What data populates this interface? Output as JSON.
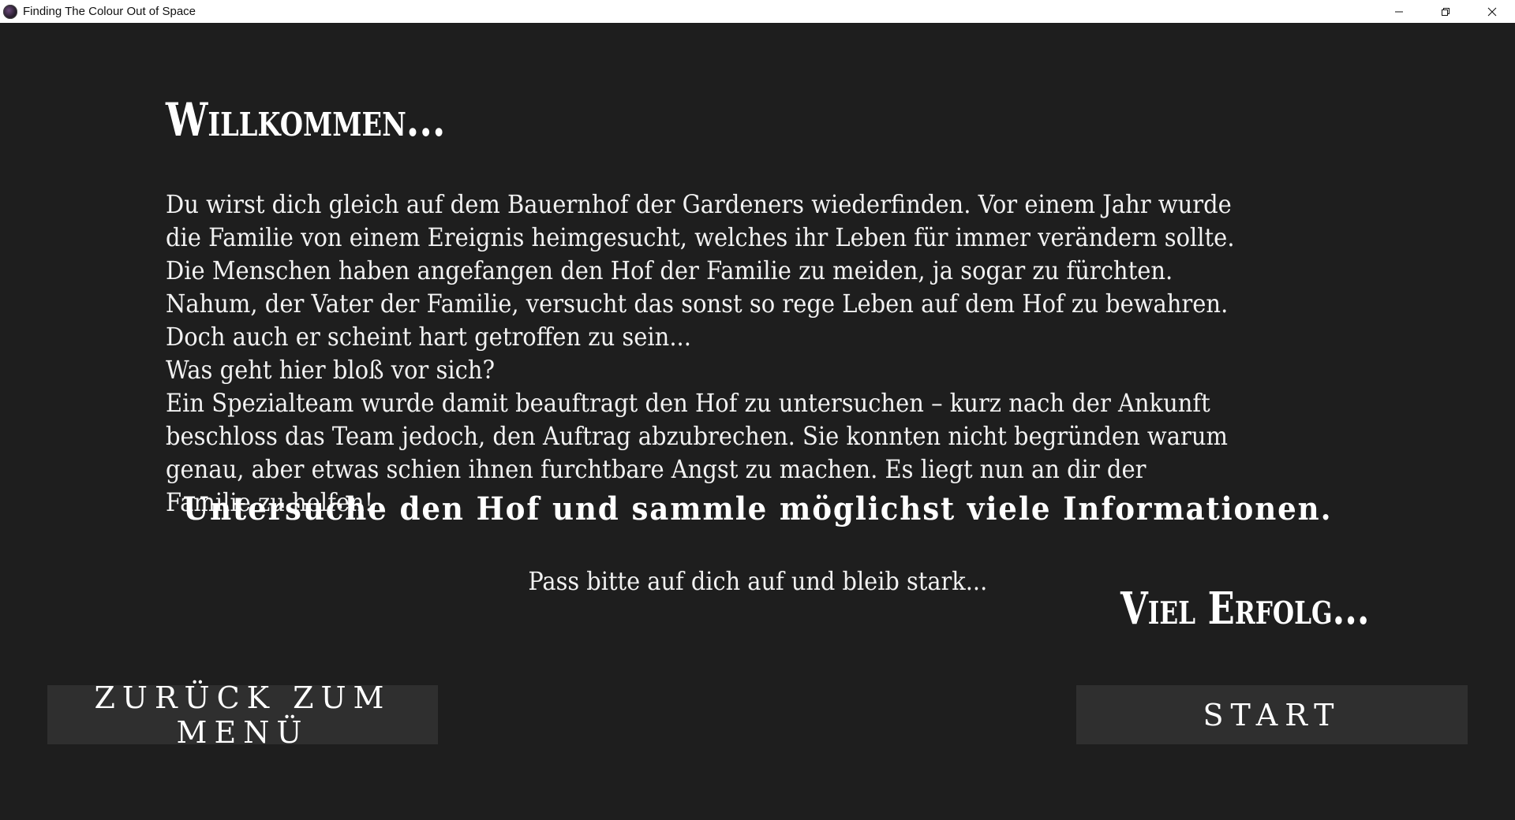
{
  "window": {
    "title": "Finding The Colour Out of Space",
    "app_icon": "dark-orb-icon",
    "controls": [
      "minimize-icon",
      "restore-icon",
      "close-icon"
    ]
  },
  "screen": {
    "heading": "Willkommen...",
    "story_paragraphs": [
      "Du wirst dich gleich auf dem Bauernhof der Gardeners wiederfinden. Vor einem Jahr wurde die Familie von einem Ereignis heimgesucht, welches ihr Leben für immer verändern sollte. Die Menschen haben angefangen den Hof der Familie zu meiden, ja sogar zu fürchten. Nahum, der Vater der Familie, versucht das sonst so rege Leben auf dem Hof zu bewahren. Doch auch er scheint hart getroffen zu sein...",
      "Was geht hier bloß vor sich?",
      "Ein Spezialteam wurde damit beauftragt den Hof zu untersuchen – kurz nach der Ankunft beschloss das Team jedoch, den Auftrag abzubrechen. Sie konnten nicht begründen warum genau, aber etwas schien ihnen furchtbare Angst zu machen. Es liegt nun an dir der Familie zu helfen!"
    ],
    "mission": "Untersuche den Hof und sammle möglichst viele Informationen.",
    "pass_text": "Pass bitte auf dich auf und bleib stark...",
    "farewell": "Viel Erfolg..."
  },
  "buttons": {
    "back_label": "ZURÜCK ZUM MENÜ",
    "start_label": "START"
  },
  "colors": {
    "background": "#1e1e1e",
    "button_bg": "#2f2f2f",
    "text": "#ffffff",
    "titlebar_bg": "#ffffff"
  }
}
